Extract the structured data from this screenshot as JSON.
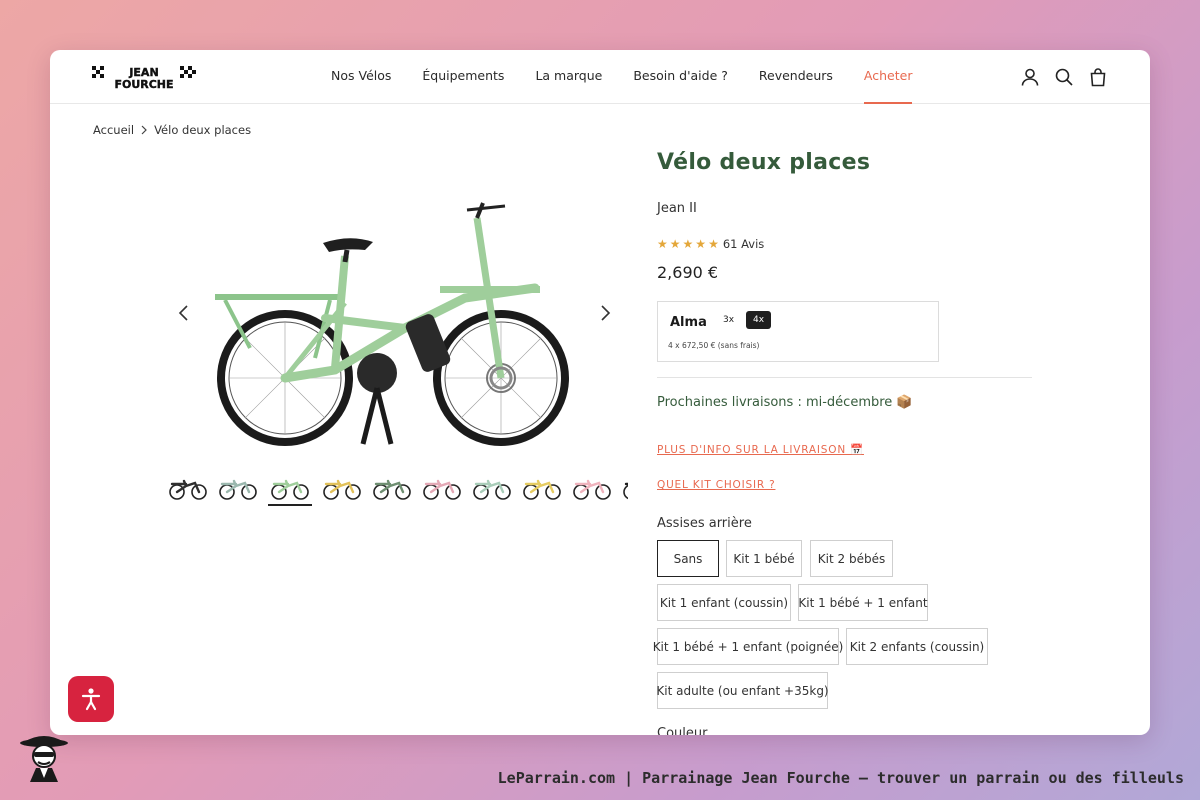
{
  "header": {
    "logo_text": [
      "JEAN",
      "FOURCHE"
    ],
    "nav": [
      {
        "label": "Nos Vélos"
      },
      {
        "label": "Équipements"
      },
      {
        "label": "La marque"
      },
      {
        "label": "Besoin d'aide ?"
      },
      {
        "label": "Revendeurs"
      },
      {
        "label": "Acheter",
        "active": true
      }
    ],
    "icons": [
      "account-icon",
      "search-icon",
      "cart-icon"
    ]
  },
  "breadcrumb": {
    "home": "Accueil",
    "current": "Vélo deux places"
  },
  "product": {
    "title": "Vélo deux places",
    "subtitle": "Jean II",
    "rating": {
      "stars": 5,
      "text": "61 Avis"
    },
    "price": "2,690 €",
    "alma": {
      "logo": "Alma",
      "options": [
        "3x",
        "4x"
      ],
      "selected": "4x",
      "detail": "4 x 672,50 € (sans frais)"
    },
    "delivery": "Prochaines livraisons : mi-décembre 📦",
    "link_info": "PLUS D'INFO SUR LA LIVRAISON 📅",
    "link_kit": "QUEL KIT CHOISIR ?",
    "seats_label": "Assises arrière",
    "seat_options": [
      "Sans",
      "Kit 1 bébé",
      "Kit 2 bébés",
      "Kit 1 enfant (coussin)",
      "Kit 1 bébé + 1 enfant",
      "Kit 1 bébé + 1 enfant (poignée)",
      "Kit 2 enfants (coussin)",
      "Kit adulte (ou enfant +35kg)"
    ],
    "seat_selected": "Sans",
    "color_label": "Couleur"
  },
  "gallery": {
    "main_color": "#9fce9b",
    "thumb_colors": [
      "#2f2f2f",
      "#9bb8ae",
      "#9fce9b",
      "#e2c15a",
      "#6f8f72",
      "#e4a9b6",
      "#a9cdb9",
      "#e6cc62",
      "#efb3bd",
      "#1e1e1e"
    ],
    "selected_thumb": 2
  },
  "colors": {
    "accent": "#e8694f",
    "title_green": "#355b3b",
    "a11y_red": "#d7233f"
  },
  "footer_caption": "LeParrain.com | Parrainage Jean Fourche — trouver un parrain ou des filleuls"
}
